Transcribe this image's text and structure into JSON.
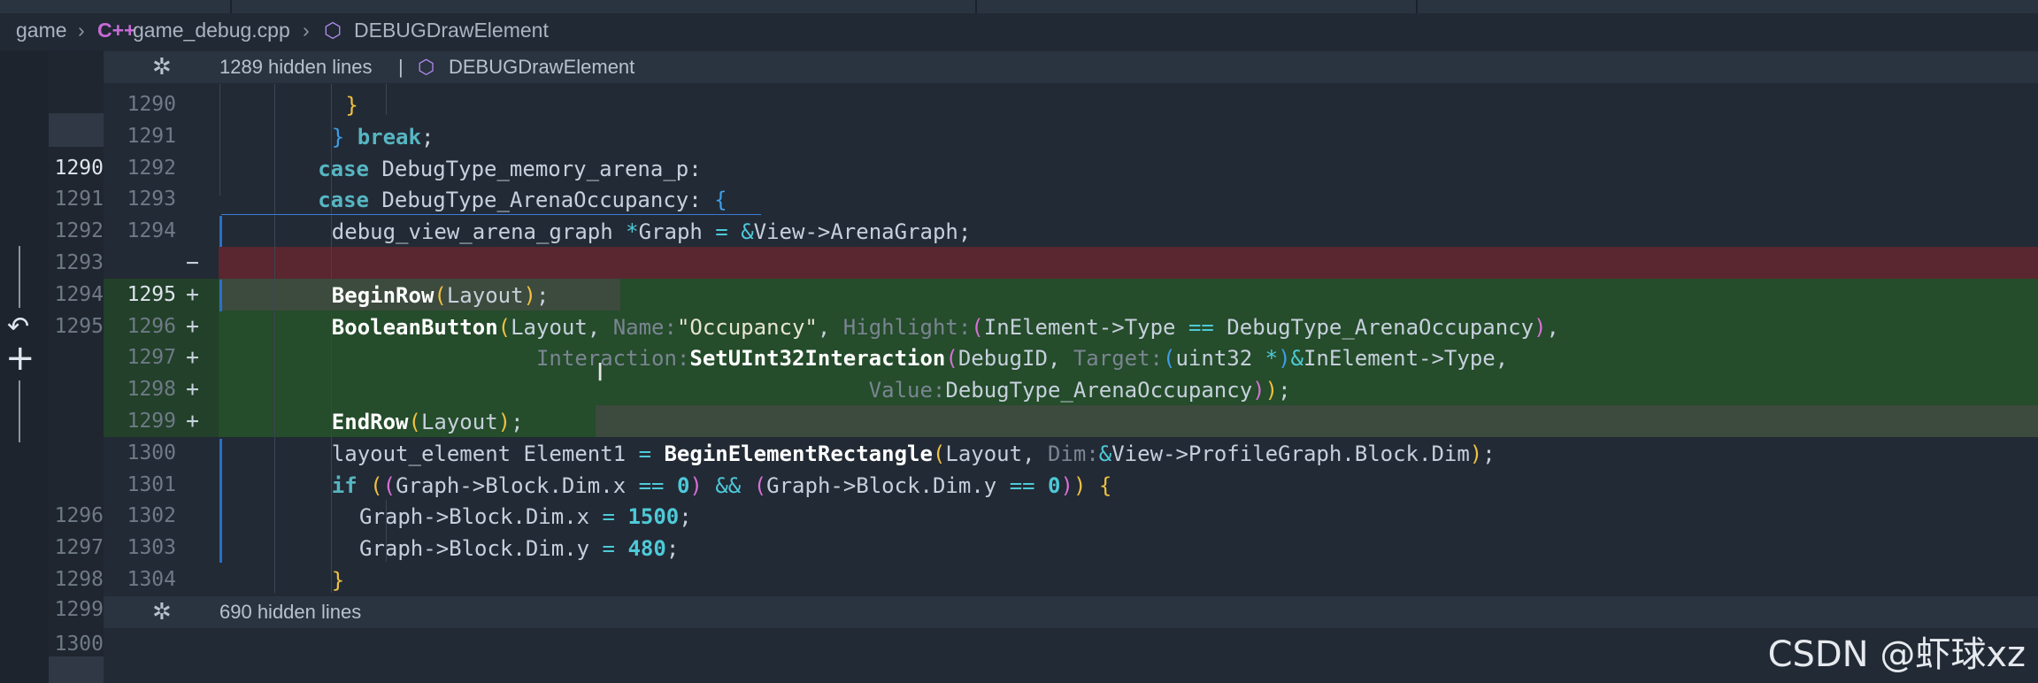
{
  "breadcrumb": {
    "folder": "game",
    "file": "game_debug.cpp",
    "symbol": "DEBUGDrawElement"
  },
  "folds": {
    "top": {
      "text": "1289 hidden lines",
      "separator": "|",
      "symbol": "DEBUGDrawElement"
    },
    "bottom": {
      "text": "690 hidden lines"
    }
  },
  "lines": [
    {
      "old": "",
      "new": "1290",
      "mark": "",
      "tokens": [
        [
          "b1",
          "}"
        ]
      ]
    },
    {
      "old": "",
      "new": "1291",
      "mark": "",
      "tokens": [
        [
          "b3",
          "}"
        ],
        [
          "t",
          " "
        ],
        [
          "k",
          "break"
        ],
        [
          "t",
          ";"
        ]
      ]
    },
    {
      "old": "1290",
      "new": "1292",
      "mark": "",
      "tokens": [
        [
          "k",
          "case"
        ],
        [
          "t",
          " DebugType_memory_arena_p:"
        ]
      ]
    },
    {
      "old": "1291",
      "new": "1293",
      "mark": "",
      "tokens": [
        [
          "k",
          "case"
        ],
        [
          "t",
          " DebugType_ArenaOccupancy: "
        ],
        [
          "b3",
          "{"
        ]
      ]
    },
    {
      "old": "1292",
      "new": "1294",
      "mark": "",
      "tokens": [
        [
          "t",
          "debug_view_arena_graph "
        ],
        [
          "o",
          "*"
        ],
        [
          "t",
          "Graph "
        ],
        [
          "o",
          "="
        ],
        [
          "t",
          " "
        ],
        [
          "o",
          "&"
        ],
        [
          "t",
          "View->ArenaGraph;"
        ]
      ]
    },
    {
      "old": "1293",
      "new": "",
      "mark": "−",
      "tokens": []
    },
    {
      "old": "1294",
      "new": "1295",
      "mark": "+",
      "tokens": [
        [
          "f",
          "BeginRow"
        ],
        [
          "b1",
          "("
        ],
        [
          "t",
          "Layout"
        ],
        [
          "b1",
          ")"
        ],
        [
          "t",
          ";"
        ]
      ]
    },
    {
      "old": "1295",
      "new": "1296",
      "mark": "+",
      "tokens": [
        [
          "f",
          "BooleanButton"
        ],
        [
          "b1",
          "("
        ],
        [
          "t",
          "Layout, "
        ],
        [
          "hint",
          "Name:"
        ],
        [
          "s",
          "\"Occupancy\""
        ],
        [
          "t",
          ", "
        ],
        [
          "hint",
          "Highlight:"
        ],
        [
          "b2",
          "("
        ],
        [
          "t",
          "InElement->Type "
        ],
        [
          "o",
          "=="
        ],
        [
          "t",
          " DebugType_ArenaOccupancy"
        ],
        [
          "b2",
          ")"
        ],
        [
          "t",
          ","
        ]
      ]
    },
    {
      "old": "",
      "new": "1297",
      "mark": "+",
      "tokens": [
        [
          "t",
          "                "
        ],
        [
          "hint",
          "Interaction:"
        ],
        [
          "f",
          "SetUInt32Interaction"
        ],
        [
          "b2",
          "("
        ],
        [
          "t",
          "DebugID, "
        ],
        [
          "hint",
          "Target:"
        ],
        [
          "b3",
          "("
        ],
        [
          "t",
          "uint32 "
        ],
        [
          "o",
          "*"
        ],
        [
          "b3",
          ")"
        ],
        [
          "o",
          "&"
        ],
        [
          "t",
          "InElement->Type,"
        ]
      ]
    },
    {
      "old": "",
      "new": "1298",
      "mark": "+",
      "tokens": [
        [
          "t",
          "                                          "
        ],
        [
          "hint",
          "Value:"
        ],
        [
          "t",
          "DebugType_ArenaOccupancy"
        ],
        [
          "b2",
          ")"
        ],
        [
          "b1",
          ")"
        ],
        [
          "t",
          ";"
        ]
      ]
    },
    {
      "old": "",
      "new": "1299",
      "mark": "+",
      "tokens": [
        [
          "f",
          "EndRow"
        ],
        [
          "b1",
          "("
        ],
        [
          "t",
          "Layout"
        ],
        [
          "b1",
          ")"
        ],
        [
          "t",
          ";"
        ]
      ]
    },
    {
      "old": "",
      "new": "1300",
      "mark": "",
      "tokens": [
        [
          "t",
          "layout_element Element1 "
        ],
        [
          "o",
          "="
        ],
        [
          "t",
          " "
        ],
        [
          "f",
          "BeginElementRectangle"
        ],
        [
          "b1",
          "("
        ],
        [
          "t",
          "Layout, "
        ],
        [
          "hint",
          "Dim:"
        ],
        [
          "o",
          "&"
        ],
        [
          "t",
          "View->ProfileGraph.Block.Dim"
        ],
        [
          "b1",
          ")"
        ],
        [
          "t",
          ";"
        ]
      ]
    },
    {
      "old": "",
      "new": "1301",
      "mark": "",
      "tokens": [
        [
          "k",
          "if"
        ],
        [
          "t",
          " "
        ],
        [
          "b1",
          "("
        ],
        [
          "b2",
          "("
        ],
        [
          "t",
          "Graph->Block.Dim.x "
        ],
        [
          "o",
          "=="
        ],
        [
          "t",
          " "
        ],
        [
          "n",
          "0"
        ],
        [
          "b2",
          ")"
        ],
        [
          "t",
          " "
        ],
        [
          "o",
          "&&"
        ],
        [
          "t",
          " "
        ],
        [
          "b2",
          "("
        ],
        [
          "t",
          "Graph->Block.Dim.y "
        ],
        [
          "o",
          "=="
        ],
        [
          "t",
          " "
        ],
        [
          "n",
          "0"
        ],
        [
          "b2",
          ")"
        ],
        [
          "b1",
          ")"
        ],
        [
          "t",
          " "
        ],
        [
          "b1",
          "{"
        ]
      ]
    },
    {
      "old": "1296",
      "new": "1302",
      "mark": "",
      "tokens": [
        [
          "t",
          "Graph->Block.Dim.x "
        ],
        [
          "o",
          "="
        ],
        [
          "t",
          " "
        ],
        [
          "n",
          "1500"
        ],
        [
          "t",
          ";"
        ]
      ]
    },
    {
      "old": "1297",
      "new": "1303",
      "mark": "",
      "tokens": [
        [
          "t",
          "Graph->Block.Dim.y "
        ],
        [
          "o",
          "="
        ],
        [
          "t",
          " "
        ],
        [
          "n",
          "480"
        ],
        [
          "t",
          ";"
        ]
      ]
    },
    {
      "old": "1298",
      "new": "1304",
      "mark": "",
      "tokens": [
        [
          "b1",
          "}"
        ]
      ]
    }
  ],
  "after_fold": {
    "old": "1299",
    "old2": "1300"
  },
  "scm_gutter": {
    "revert_icon": "↶",
    "plus_icon": "+"
  },
  "watermark": "CSDN @虾球xz"
}
